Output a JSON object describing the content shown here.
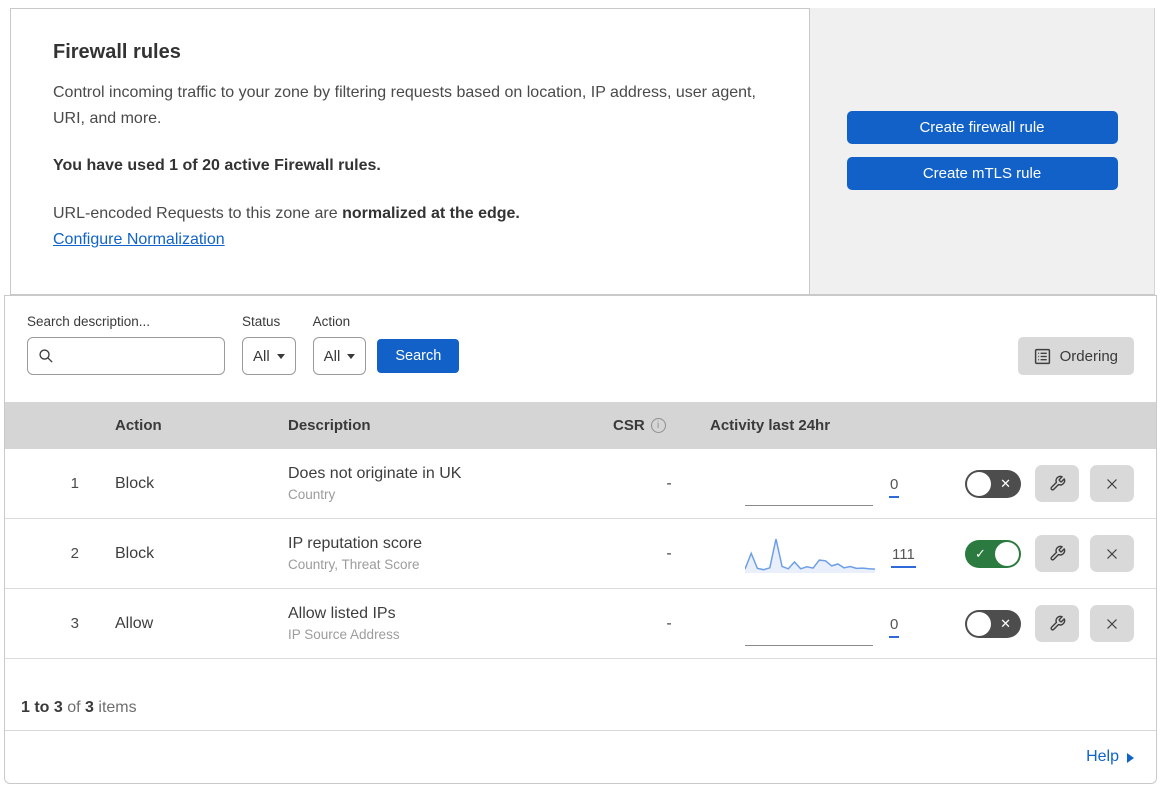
{
  "intro": {
    "title": "Firewall rules",
    "description": "Control incoming traffic to your zone by filtering requests based on location, IP address, user agent, URI, and more.",
    "usage_statement": "You have used 1 of 20 active Firewall rules.",
    "normalization_prefix": "URL-encoded Requests to this zone are ",
    "normalization_bold": "normalized at the edge.",
    "normalization_link": "Configure Normalization"
  },
  "actions_panel": {
    "create_firewall_label": "Create firewall rule",
    "create_mtls_label": "Create mTLS rule"
  },
  "filters": {
    "search_label": "Search description...",
    "search_value": "",
    "status_label": "Status",
    "status_value": "All",
    "action_label": "Action",
    "action_value": "All",
    "search_button_label": "Search",
    "ordering_button_label": "Ordering"
  },
  "table": {
    "headers": {
      "action": "Action",
      "description": "Description",
      "csr": "CSR",
      "activity": "Activity last 24hr"
    },
    "rows": [
      {
        "index": "1",
        "action": "Block",
        "description": "Does not originate in UK",
        "fields": "Country",
        "csr": "-",
        "activity_count": "0",
        "enabled": false
      },
      {
        "index": "2",
        "action": "Block",
        "description": "IP reputation score",
        "fields": "Country, Threat Score",
        "csr": "-",
        "activity_count": "111",
        "enabled": true
      },
      {
        "index": "3",
        "action": "Allow",
        "description": "Allow listed IPs",
        "fields": "IP Source Address",
        "csr": "-",
        "activity_count": "0",
        "enabled": false
      }
    ]
  },
  "chart_data": {
    "type": "area",
    "title": "Activity last 24hr sparkline (rule 2)",
    "x_span": "last 24 hours",
    "values": [
      6,
      55,
      8,
      4,
      10,
      100,
      14,
      7,
      28,
      7,
      13,
      9,
      34,
      32,
      16,
      22,
      10,
      14,
      8,
      9,
      7,
      6
    ],
    "total_events": 111,
    "line_color": "#6d9fe8",
    "fill_color": "#eaf0fb"
  },
  "footer": {
    "range_bold": "1 to 3",
    "of_text": " of ",
    "total_bold": "3",
    "items_text": " items",
    "help_label": "Help"
  },
  "colors": {
    "primary_blue": "#1161c8",
    "link_blue": "#1063c9",
    "toggle_on_green": "#2b7a3f",
    "toggle_off_gray": "#4d4d4d",
    "table_header_gray": "#d5d5d5",
    "panel_gray": "#f0f0f0",
    "icon_button_gray": "#d9d9d9"
  }
}
